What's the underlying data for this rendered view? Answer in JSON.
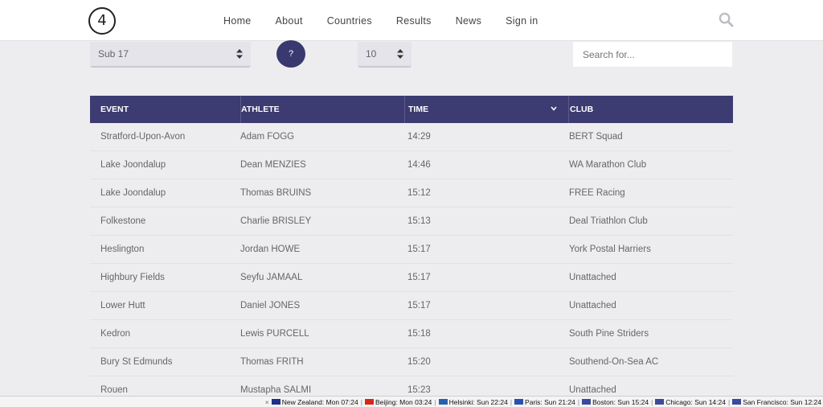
{
  "header": {
    "logo_glyph": "4",
    "nav": [
      "Home",
      "About",
      "Countries",
      "Results",
      "News",
      "Sign in"
    ]
  },
  "filters": {
    "age_group": "Sub 17",
    "help_label": "?",
    "count": "10",
    "search_placeholder": "Search for..."
  },
  "table": {
    "headers": [
      "EVENT",
      "ATHLETE",
      "TIME",
      "CLUB"
    ],
    "rows": [
      [
        "Stratford-Upon-Avon",
        "Adam FOGG",
        "14:29",
        "BERT Squad"
      ],
      [
        "Lake Joondalup",
        "Dean MENZIES",
        "14:46",
        "WA Marathon Club"
      ],
      [
        "Lake Joondalup",
        "Thomas BRUINS",
        "15:12",
        "FREE Racing"
      ],
      [
        "Folkestone",
        "Charlie BRISLEY",
        "15:13",
        "Deal Triathlon Club"
      ],
      [
        "Heslington",
        "Jordan HOWE",
        "15:17",
        "York Postal Harriers"
      ],
      [
        "Highbury Fields",
        "Seyfu JAMAAL",
        "15:17",
        "Unattached"
      ],
      [
        "Lower Hutt",
        "Daniel JONES",
        "15:17",
        "Unattached"
      ],
      [
        "Kedron",
        "Lewis PURCELL",
        "15:18",
        "South Pine Striders"
      ],
      [
        "Bury St Edmunds",
        "Thomas FRITH",
        "15:20",
        "Southend-On-Sea AC"
      ],
      [
        "Rouen",
        "Mustapha SALMI",
        "15:23",
        "Unattached"
      ]
    ]
  },
  "clock_bar": {
    "close": "×",
    "clocks": [
      {
        "label": "New Zealand: Mon 07:24",
        "flag_color": "#1f2f8a"
      },
      {
        "label": "Beijing: Mon 03:24",
        "flag_color": "#d9261c"
      },
      {
        "label": "Helsinki: Sun 22:24",
        "flag_color": "#2a5fb0"
      },
      {
        "label": "Paris: Sun 21:24",
        "flag_color": "#2a4fb0"
      },
      {
        "label": "Boston: Sun 15:24",
        "flag_color": "#3b4a9a"
      },
      {
        "label": "Chicago: Sun 14:24",
        "flag_color": "#3b4a9a"
      },
      {
        "label": "San Francisco: Sun 12:24",
        "flag_color": "#3b4a9a"
      }
    ]
  },
  "colors": {
    "accent": "#3c3c72",
    "background": "#ededf0"
  }
}
